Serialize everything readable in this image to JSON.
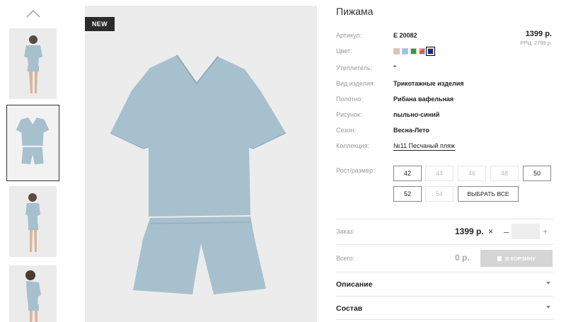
{
  "badge": {
    "new": "NEW"
  },
  "product": {
    "title": "Пижама",
    "price": "1399 р.",
    "rrc": "РРЦ: 2799 р."
  },
  "attributes": {
    "article": {
      "label": "Артикул:",
      "value": "Е 20082"
    },
    "color": {
      "label": "Цвет:"
    },
    "insulation": {
      "label": "Утеплитель:",
      "value": "\""
    },
    "type": {
      "label": "Вид изделия:",
      "value": "Трикотажные изделия"
    },
    "fabric": {
      "label": "Полотно:",
      "value": "Рибана вафельная"
    },
    "pattern": {
      "label": "Рисунок:",
      "value": "пыльно-синий"
    },
    "season": {
      "label": "Сезон:",
      "value": "Весна-Лето"
    },
    "collection": {
      "label": "Коллекция:",
      "value": "№11 Песчаный пляж"
    }
  },
  "swatch_colors": [
    "#d8c8a8",
    "#8cc8ee",
    "#2e9a52",
    "#e0a070",
    "#1c2a7a"
  ],
  "sizes": {
    "label": "Рост/размер:",
    "items": [
      {
        "label": "42",
        "available": true
      },
      {
        "label": "44",
        "available": false
      },
      {
        "label": "46",
        "available": false
      },
      {
        "label": "48",
        "available": false
      },
      {
        "label": "50",
        "available": true
      },
      {
        "label": "52",
        "available": true
      },
      {
        "label": "54",
        "available": false
      }
    ],
    "select_all": "ВЫБРАТЬ ВСЕ"
  },
  "order": {
    "label": "Заказ:",
    "price": "1399 р.",
    "remove": "×",
    "minus": "–",
    "plus": "+"
  },
  "total": {
    "label": "Всего:",
    "value": "0 р.",
    "cart_button": "В КОРЗИНУ"
  },
  "accordion": {
    "description": "Описание",
    "composition": "Состав"
  },
  "colors": {
    "garment": "#a7c0cd",
    "accent_dark": "#2b2b2b",
    "disabled_button": "#d5d5d5"
  }
}
